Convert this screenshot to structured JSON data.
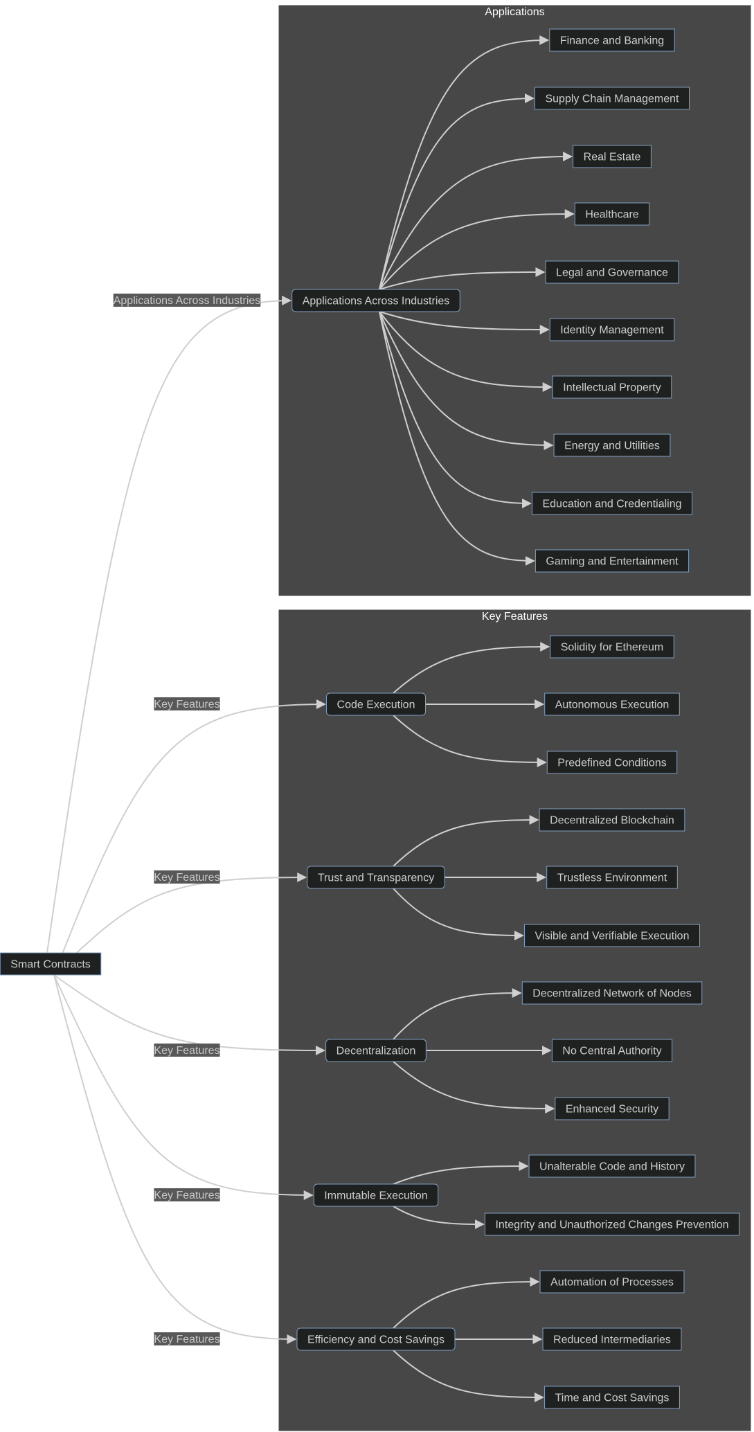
{
  "root": {
    "label": "Smart Contracts"
  },
  "clusters": [
    {
      "id": "applications",
      "title": "Applications"
    },
    {
      "id": "key-features",
      "title": "Key Features"
    }
  ],
  "applications": {
    "edge_label": "Applications Across Industries",
    "hub": "Applications Across Industries",
    "items": [
      "Finance and Banking",
      "Supply Chain Management",
      "Real Estate",
      "Healthcare",
      "Legal and Governance",
      "Identity Management",
      "Intellectual Property",
      "Energy and Utilities",
      "Education and Credentialing",
      "Gaming and Entertainment"
    ]
  },
  "features": [
    {
      "edge_label": "Key Features",
      "hub": "Code Execution",
      "items": [
        "Solidity for Ethereum",
        "Autonomous Execution",
        "Predefined Conditions"
      ]
    },
    {
      "edge_label": "Key Features",
      "hub": "Trust and Transparency",
      "items": [
        "Decentralized Blockchain",
        "Trustless Environment",
        "Visible and Verifiable Execution"
      ]
    },
    {
      "edge_label": "Key Features",
      "hub": "Decentralization",
      "items": [
        "Decentralized Network of Nodes",
        "No Central Authority",
        "Enhanced Security"
      ]
    },
    {
      "edge_label": "Key Features",
      "hub": "Immutable Execution",
      "items": [
        "Unalterable Code and History",
        "Integrity and Unauthorized Changes Prevention"
      ]
    },
    {
      "edge_label": "Key Features",
      "hub": "Efficiency and Cost Savings",
      "items": [
        "Automation of Processes",
        "Reduced Intermediaries",
        "Time and Cost Savings"
      ]
    }
  ],
  "colors": {
    "cluster": "#474747",
    "node_fill": "#1f2020",
    "node_stroke": "#81a1c1",
    "edge": "#cfcfcf",
    "text": "#cccccc"
  }
}
